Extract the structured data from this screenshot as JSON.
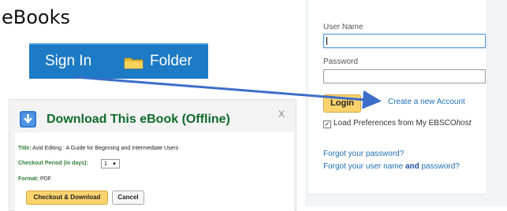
{
  "page": {
    "title": "eBooks"
  },
  "toolbar": {
    "sign_in": "Sign In",
    "folder": "Folder",
    "folder_icon": "folder-icon"
  },
  "dialog": {
    "title": "Download This eBook (Offline)",
    "close": "X",
    "title_label": "Title:",
    "title_value": "Avid Editing : A Guide for Beginning and Intermediate Users",
    "checkout_label": "Checkout Period (in days):",
    "checkout_value": "1",
    "format_label": "Format:",
    "format_value": "PDF",
    "checkout_button": "Checkout & Download",
    "cancel_button": "Cancel"
  },
  "login": {
    "username_label": "User Name",
    "username_value": "",
    "password_label": "Password",
    "password_value": "",
    "login_button": "Login",
    "create_account": "Create a new Account",
    "prefs_prefix": "Load Preferences from My EBSCO",
    "prefs_suffix": "host",
    "prefs_checked": true,
    "forgot_password": "Forgot your password?",
    "forgot_user_prefix": "Forgot your user name ",
    "forgot_user_and": "and",
    "forgot_user_suffix": " password?"
  },
  "colors": {
    "toolbar": "#1d7ac4",
    "accent_button": "#fcd36d",
    "link": "#1f6fb5",
    "dialog_title": "#0f6c2c",
    "arrow": "#3d6fc9"
  }
}
